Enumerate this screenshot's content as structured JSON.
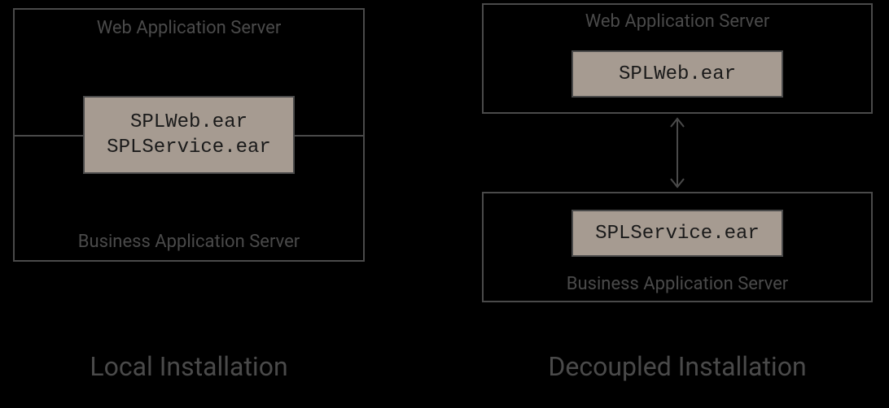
{
  "left": {
    "top_label": "Web Application Server",
    "bottom_label": "Business Application Server",
    "ear_line1": "SPLWeb.ear",
    "ear_line2": "SPLService.ear",
    "title": "Local Installation"
  },
  "right": {
    "top_label": "Web Application Server",
    "top_ear": "SPLWeb.ear",
    "bottom_label": "Business Application Server",
    "bottom_ear": "SPLService.ear",
    "title": "Decoupled Installation"
  },
  "colors": {
    "border": "#4a4a4a",
    "ear_fill": "#a69b91",
    "text": "#4a4a4a"
  }
}
